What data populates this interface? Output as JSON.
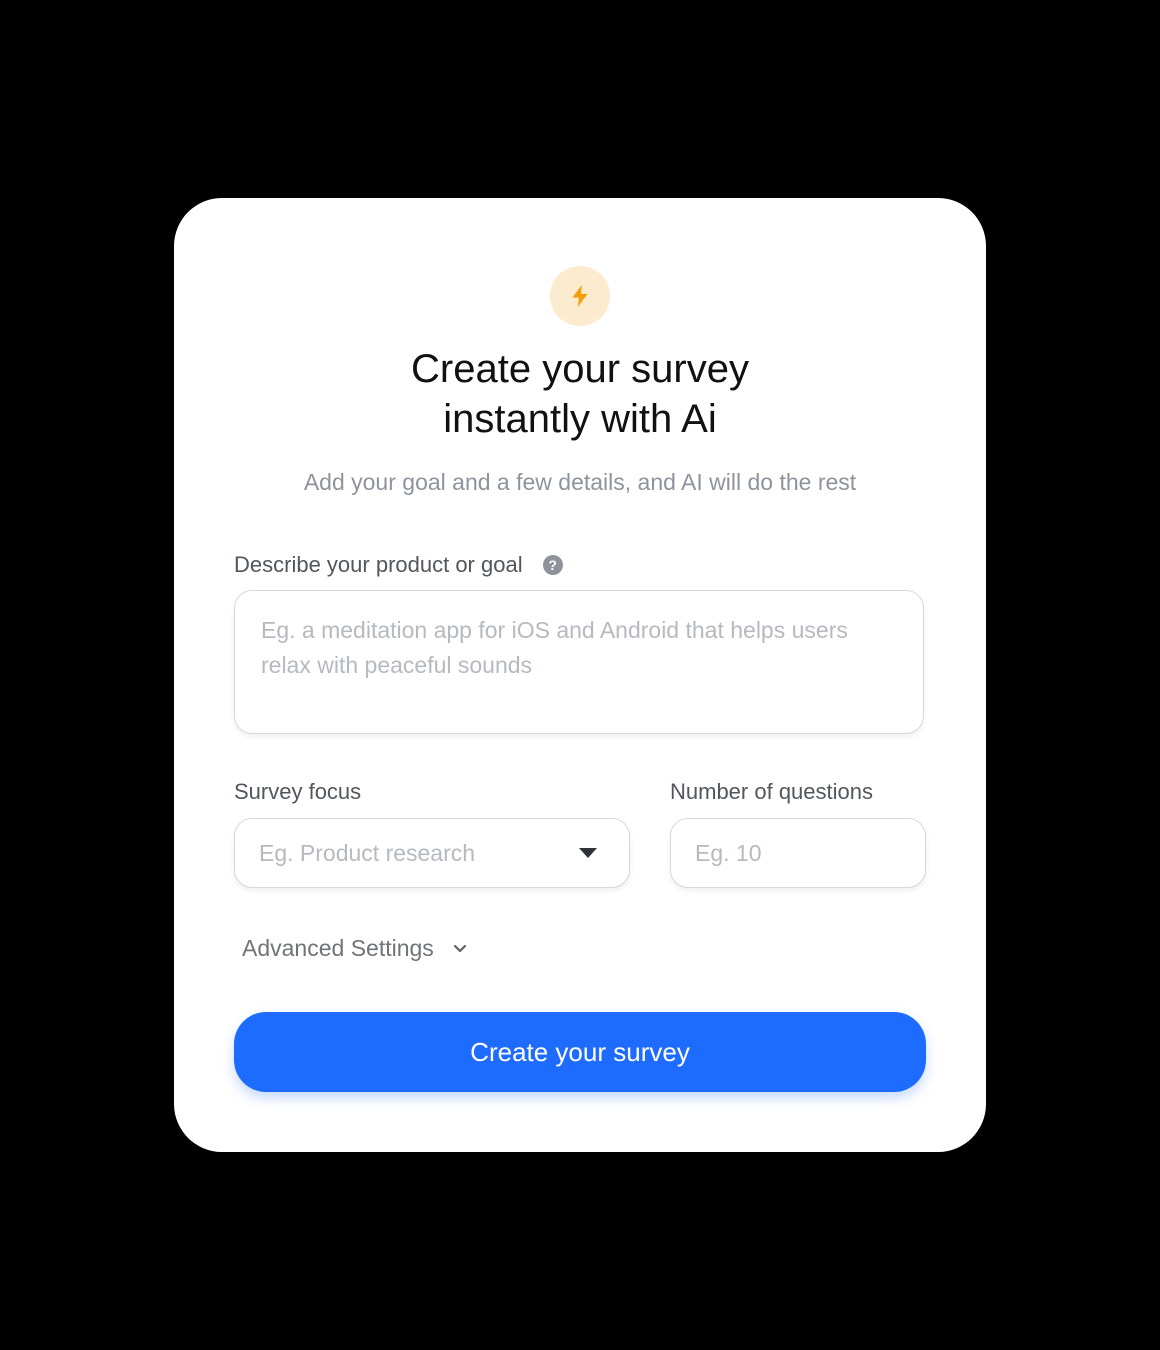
{
  "header": {
    "icon": "lightning-bolt-icon",
    "title_line1": "Create your survey",
    "title_line2": "instantly with Ai",
    "subtitle": "Add your goal and a few details, and AI will do the rest"
  },
  "goal_field": {
    "label": "Describe your product or goal",
    "help_icon": "question-circle-icon",
    "help_glyph": "?",
    "placeholder": "Eg. a meditation app for iOS and Android that helps users relax with peaceful sounds",
    "value": ""
  },
  "focus_field": {
    "label": "Survey focus",
    "placeholder": "Eg. Product research",
    "icon": "caret-down-icon"
  },
  "questions_field": {
    "label": "Number of questions",
    "placeholder": "Eg. 10",
    "value": ""
  },
  "advanced": {
    "label": "Advanced Settings",
    "icon": "chevron-down-icon"
  },
  "cta": {
    "label": "Create your survey"
  },
  "colors": {
    "background": "#000000",
    "card": "#ffffff",
    "accent": "#1e6bff",
    "badge_bg": "#fdebcf",
    "bolt": "#f59e0b"
  }
}
